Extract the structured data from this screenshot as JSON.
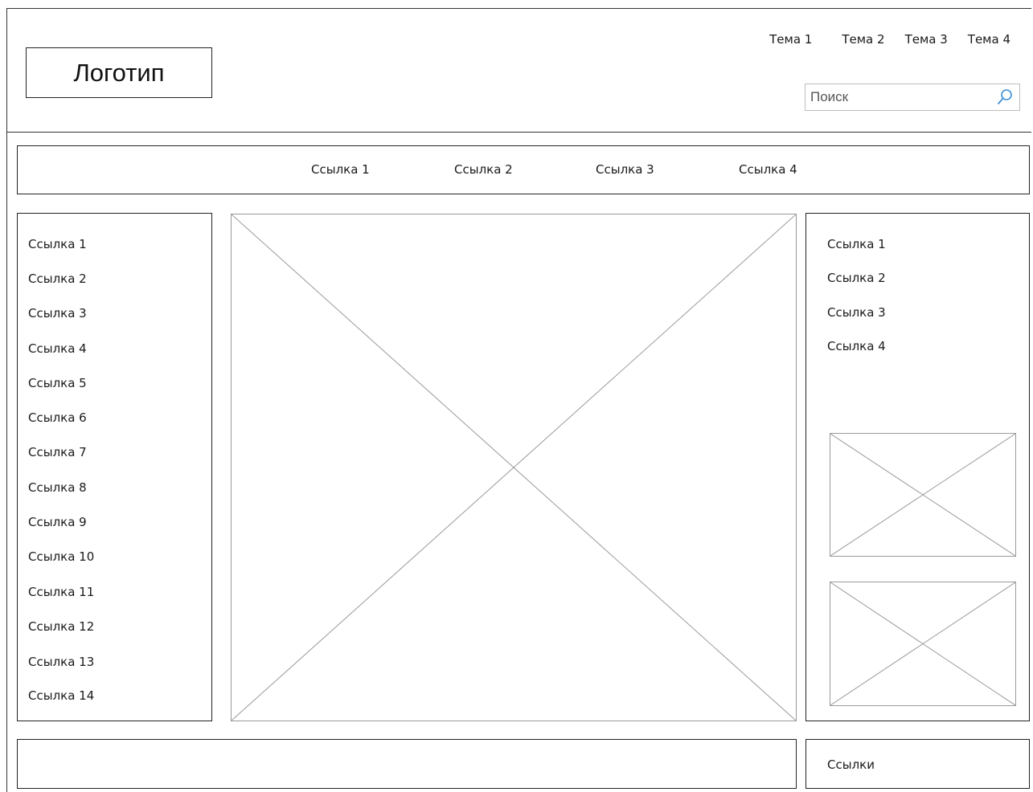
{
  "header": {
    "logo_text": "Логотип",
    "topics": [
      "Тема 1",
      "Тема 2",
      "Тема 3",
      "Тема 4"
    ],
    "search": {
      "placeholder": "Поиск",
      "value": ""
    }
  },
  "navbar": {
    "links": [
      "Ссылка 1",
      "Ссылка 2",
      "Ссылка 3",
      "Ссылка 4"
    ]
  },
  "left_sidebar": {
    "links": [
      "Ссылка 1",
      "Ссылка 2",
      "Ссылка 3",
      "Ссылка 4",
      "Ссылка 5",
      "Ссылка 6",
      "Ссылка 7",
      "Ссылка 8",
      "Ссылка 9",
      "Ссылка 10",
      "Ссылка 11",
      "Ссылка 12",
      "Ссылка 13",
      "Ссылка 14"
    ]
  },
  "right_sidebar": {
    "links": [
      "Ссылка 1",
      "Ссылка 2",
      "Ссылка 3",
      "Ссылка 4"
    ]
  },
  "footer": {
    "links_label": "Ссылки"
  },
  "icons": {
    "search": "search-icon",
    "image_placeholder": "image-placeholder-icon"
  },
  "colors": {
    "sketch_border": "#222222",
    "placeholder_lines": "#9a9a9a",
    "search_icon": "#3b8fd6"
  }
}
